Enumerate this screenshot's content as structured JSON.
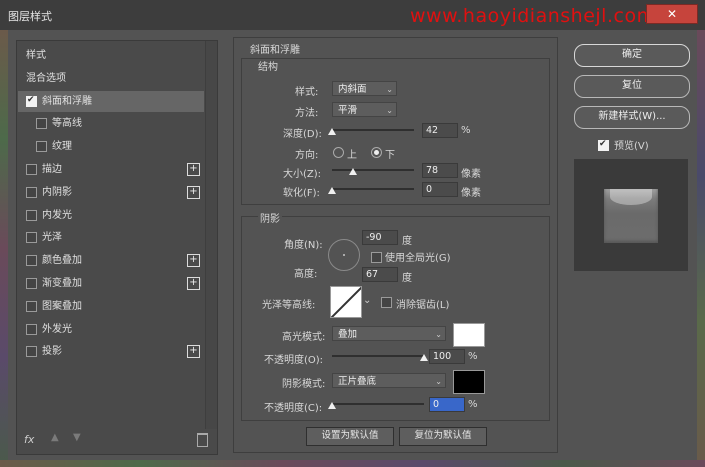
{
  "window": {
    "title": "图层样式",
    "watermark": "www.haoyidianshejl.com",
    "close_icon": "close-icon"
  },
  "sidebar": {
    "items": [
      {
        "label": "样式",
        "checkbox": false,
        "checked": false,
        "plus": false,
        "active": false,
        "indent": 0
      },
      {
        "label": "混合选项",
        "checkbox": false,
        "checked": false,
        "plus": false,
        "active": false,
        "indent": 0
      },
      {
        "label": "斜面和浮雕",
        "checkbox": true,
        "checked": true,
        "plus": false,
        "active": true,
        "indent": 0
      },
      {
        "label": "等高线",
        "checkbox": true,
        "checked": false,
        "plus": false,
        "active": false,
        "indent": 1
      },
      {
        "label": "纹理",
        "checkbox": true,
        "checked": false,
        "plus": false,
        "active": false,
        "indent": 1
      },
      {
        "label": "描边",
        "checkbox": true,
        "checked": false,
        "plus": true,
        "active": false,
        "indent": 0
      },
      {
        "label": "内阴影",
        "checkbox": true,
        "checked": false,
        "plus": true,
        "active": false,
        "indent": 0
      },
      {
        "label": "内发光",
        "checkbox": true,
        "checked": false,
        "plus": false,
        "active": false,
        "indent": 0
      },
      {
        "label": "光泽",
        "checkbox": true,
        "checked": false,
        "plus": false,
        "active": false,
        "indent": 0
      },
      {
        "label": "颜色叠加",
        "checkbox": true,
        "checked": false,
        "plus": true,
        "active": false,
        "indent": 0
      },
      {
        "label": "渐变叠加",
        "checkbox": true,
        "checked": false,
        "plus": true,
        "active": false,
        "indent": 0
      },
      {
        "label": "图案叠加",
        "checkbox": true,
        "checked": false,
        "plus": false,
        "active": false,
        "indent": 0
      },
      {
        "label": "外发光",
        "checkbox": true,
        "checked": false,
        "plus": false,
        "active": false,
        "indent": 0
      },
      {
        "label": "投影",
        "checkbox": true,
        "checked": false,
        "plus": true,
        "active": false,
        "indent": 0
      }
    ],
    "plus_glyph": "+",
    "fx_label": "fx"
  },
  "bevel": {
    "section_title": "斜面和浮雕",
    "structure": {
      "title": "结构",
      "style_label": "样式:",
      "style_value": "内斜面",
      "technique_label": "方法:",
      "technique_value": "平滑",
      "depth_label": "深度(D):",
      "depth_value": "42",
      "depth_unit": "%",
      "direction_label": "方向:",
      "dir_up": "上",
      "dir_down": "下",
      "dir_selected": "下",
      "size_label": "大小(Z):",
      "size_value": "78",
      "size_unit": "像素",
      "soften_label": "软化(F):",
      "soften_value": "0",
      "soften_unit": "像素"
    },
    "shading": {
      "title": "阴影",
      "angle_label": "角度(N):",
      "angle_value": "-90",
      "angle_unit": "度",
      "global_light_label": "使用全局光(G)",
      "global_light_checked": false,
      "altitude_label": "高度:",
      "altitude_value": "67",
      "altitude_unit": "度",
      "gloss_label": "光泽等高线:",
      "antialias_label": "消除锯齿(L)",
      "antialias_checked": false,
      "highlight_mode_label": "高光模式:",
      "highlight_mode_value": "叠加",
      "highlight_color": "#ffffff",
      "highlight_opacity_label": "不透明度(O):",
      "highlight_opacity_value": "100",
      "highlight_opacity_unit": "%",
      "shadow_mode_label": "阴影模式:",
      "shadow_mode_value": "正片叠底",
      "shadow_color": "#000000",
      "shadow_opacity_label": "不透明度(C):",
      "shadow_opacity_value": "0",
      "shadow_opacity_unit": "%"
    },
    "make_default": "设置为默认值",
    "reset_default": "复位为默认值"
  },
  "right": {
    "ok": "确定",
    "reset": "复位",
    "new_style": "新建样式(W)...",
    "preview_label": "预览(V)",
    "preview_checked": true
  },
  "levels": {
    "depth_pct": 0.0,
    "size_pct": 0.25,
    "soften_pct": 0.0,
    "highlight_opacity_pct": 1.0,
    "shadow_opacity_pct": 0.0
  },
  "colors": {
    "window_bg": "#535353",
    "close_button": "#c6443c",
    "watermark": "#e01010"
  }
}
